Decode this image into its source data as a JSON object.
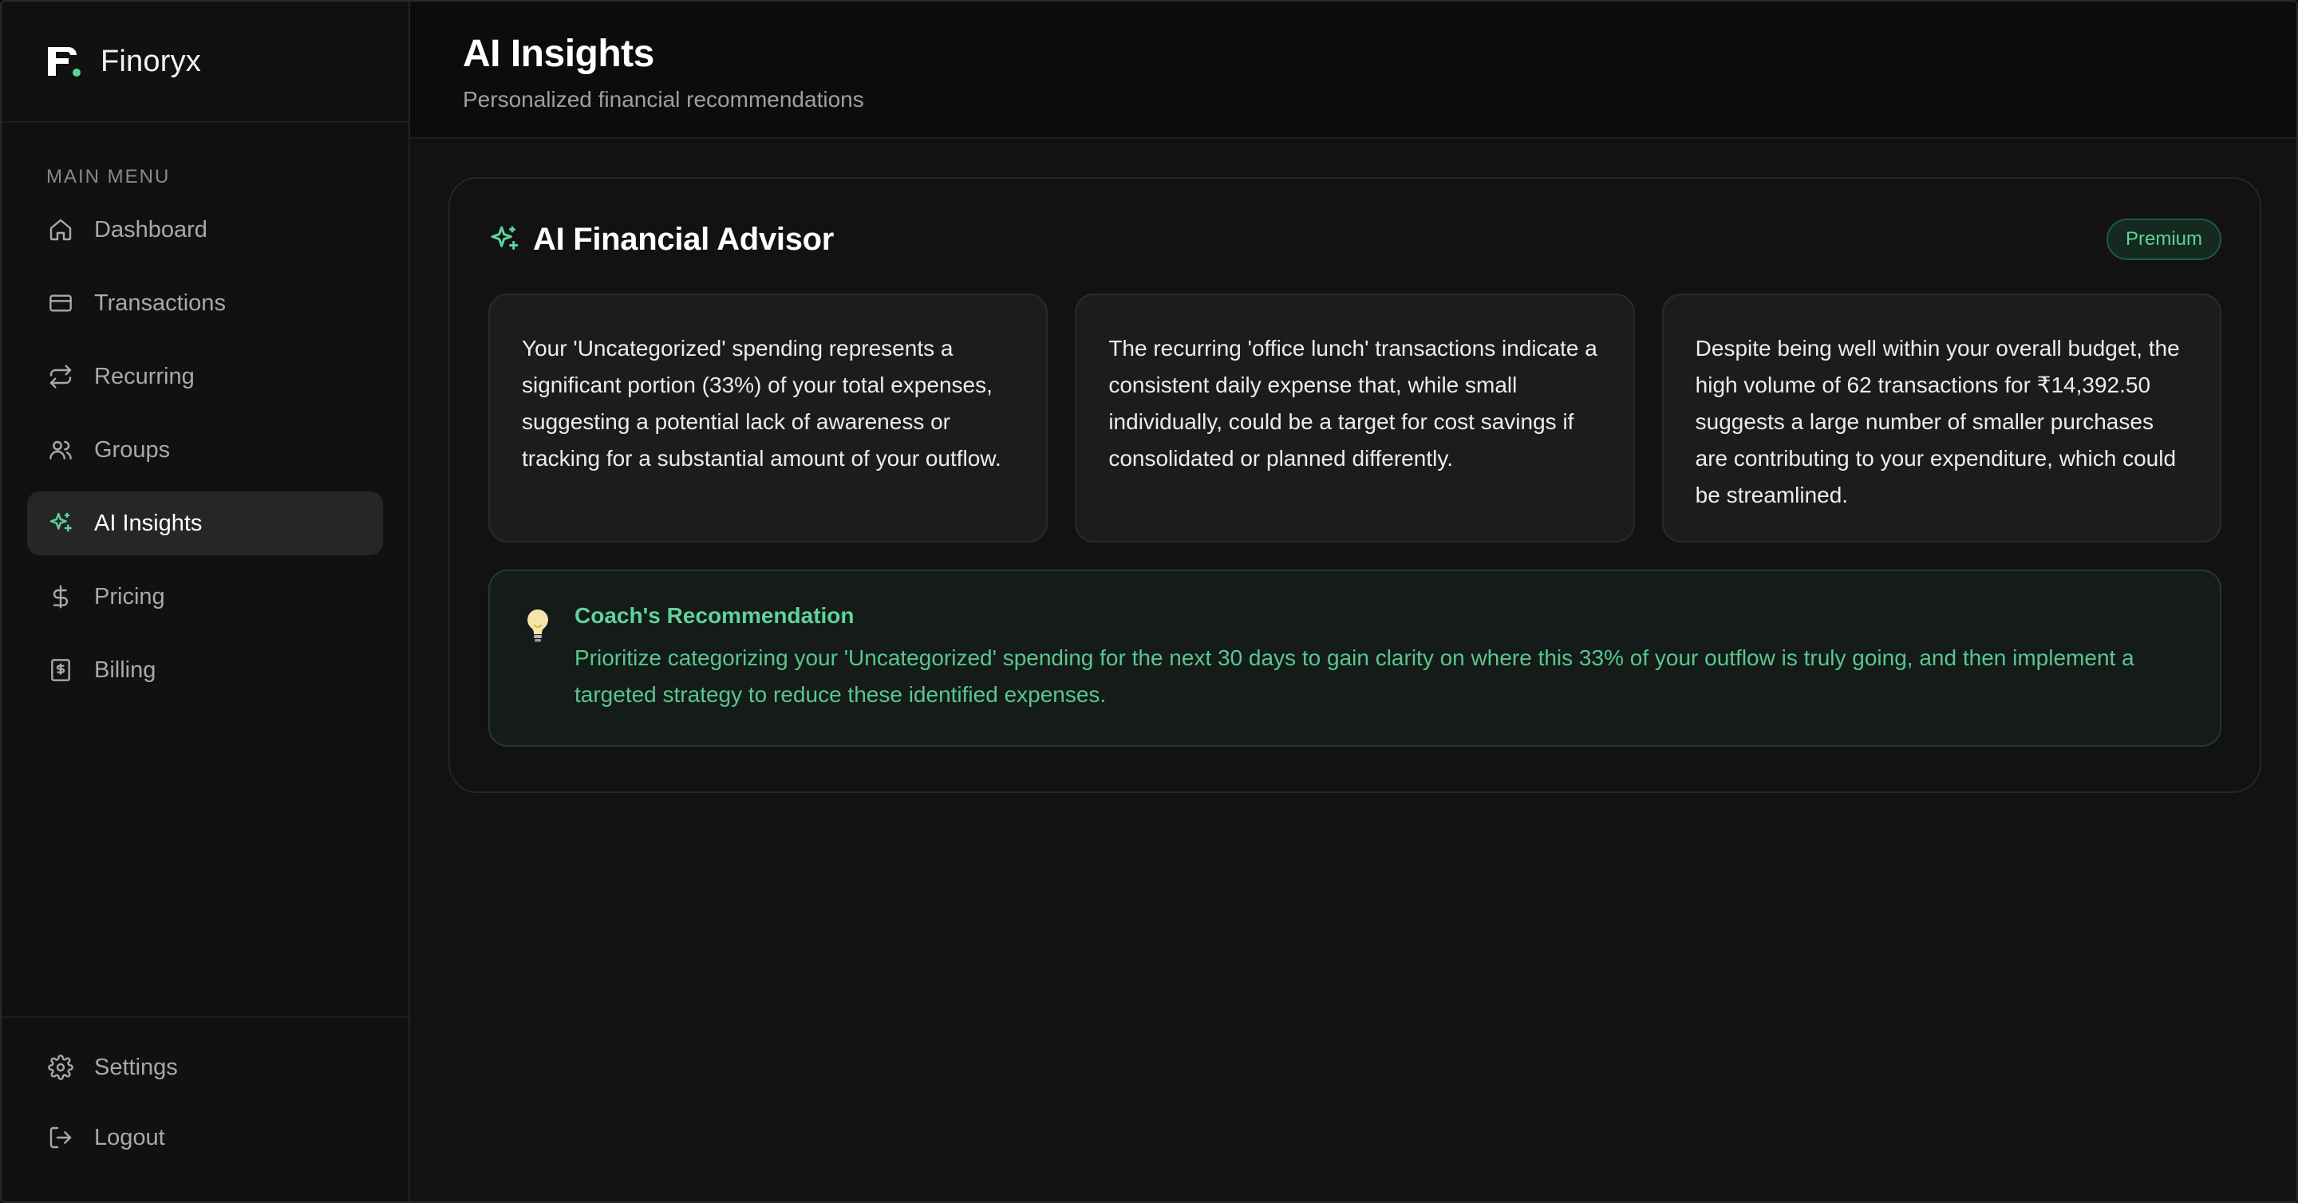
{
  "brand": {
    "name": "Finoryx",
    "accent": "#5fd39a"
  },
  "sidebar": {
    "heading": "MAIN MENU",
    "items": [
      {
        "label": "Dashboard",
        "icon": "home-icon",
        "active": false
      },
      {
        "label": "Transactions",
        "icon": "credit-card-icon",
        "active": false
      },
      {
        "label": "Recurring",
        "icon": "repeat-icon",
        "active": false
      },
      {
        "label": "Groups",
        "icon": "users-icon",
        "active": false
      },
      {
        "label": "AI Insights",
        "icon": "sparkles-icon",
        "active": true
      },
      {
        "label": "Pricing",
        "icon": "dollar-icon",
        "active": false
      },
      {
        "label": "Billing",
        "icon": "receipt-icon",
        "active": false
      }
    ],
    "bottom": [
      {
        "label": "Settings",
        "icon": "gear-icon"
      },
      {
        "label": "Logout",
        "icon": "logout-icon"
      }
    ]
  },
  "header": {
    "title": "AI Insights",
    "subtitle": "Personalized financial recommendations"
  },
  "advisor": {
    "title": "AI Financial Advisor",
    "badge": "Premium",
    "insights": [
      "Your 'Uncategorized' spending represents a significant portion (33%) of your total expenses, suggesting a potential lack of awareness or tracking for a substantial amount of your outflow.",
      "The recurring 'office lunch' transactions indicate a consistent daily expense that, while small individually, could be a target for cost savings if consolidated or planned differently.",
      "Despite being well within your overall budget, the high volume of 62 transactions for ₹14,392.50 suggests a large number of smaller purchases are contributing to your expenditure, which could be streamlined."
    ],
    "coach": {
      "title": "Coach's Recommendation",
      "text": "Prioritize categorizing your 'Uncategorized' spending for the next 30 days to gain clarity on where this 33% of your outflow is truly going, and then implement a targeted strategy to reduce these identified expenses.",
      "icon": "lightbulb-icon"
    }
  }
}
